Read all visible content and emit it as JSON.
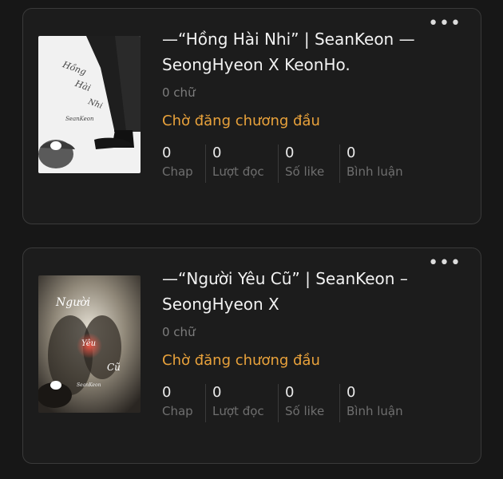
{
  "stories": [
    {
      "title": "—“Hồng Hài Nhi” | SeanKeon — SeongHyeon X KeonHo.",
      "words": "0 chữ",
      "status": "Chờ đăng chương đầu",
      "cover_text": [
        "Hồng",
        "Hài",
        "Nhi",
        "SeanKeon"
      ],
      "stats": [
        {
          "value": "0",
          "label": "Chap"
        },
        {
          "value": "0",
          "label": "Lượt đọc"
        },
        {
          "value": "0",
          "label": "Số like"
        },
        {
          "value": "0",
          "label": "Bình luận"
        }
      ]
    },
    {
      "title": "—“Người Yêu Cũ” | SeanKeon – SeongHyeon X",
      "words": "0 chữ",
      "status": "Chờ đăng chương đầu",
      "cover_text": [
        "Người",
        "Yêu",
        "Cũ",
        "SeanKeon"
      ],
      "stats": [
        {
          "value": "0",
          "label": "Chap"
        },
        {
          "value": "0",
          "label": "Lượt đọc"
        },
        {
          "value": "0",
          "label": "Số like"
        },
        {
          "value": "0",
          "label": "Bình luận"
        }
      ]
    }
  ],
  "icons": {
    "more": "more-horizontal-icon",
    "comment": "chat-bubble-icon"
  },
  "colors": {
    "background": "#171717",
    "card": "#1c1c1c",
    "border": "#3a3a3a",
    "status": "#e9a23b",
    "muted": "#7d7d7d"
  }
}
